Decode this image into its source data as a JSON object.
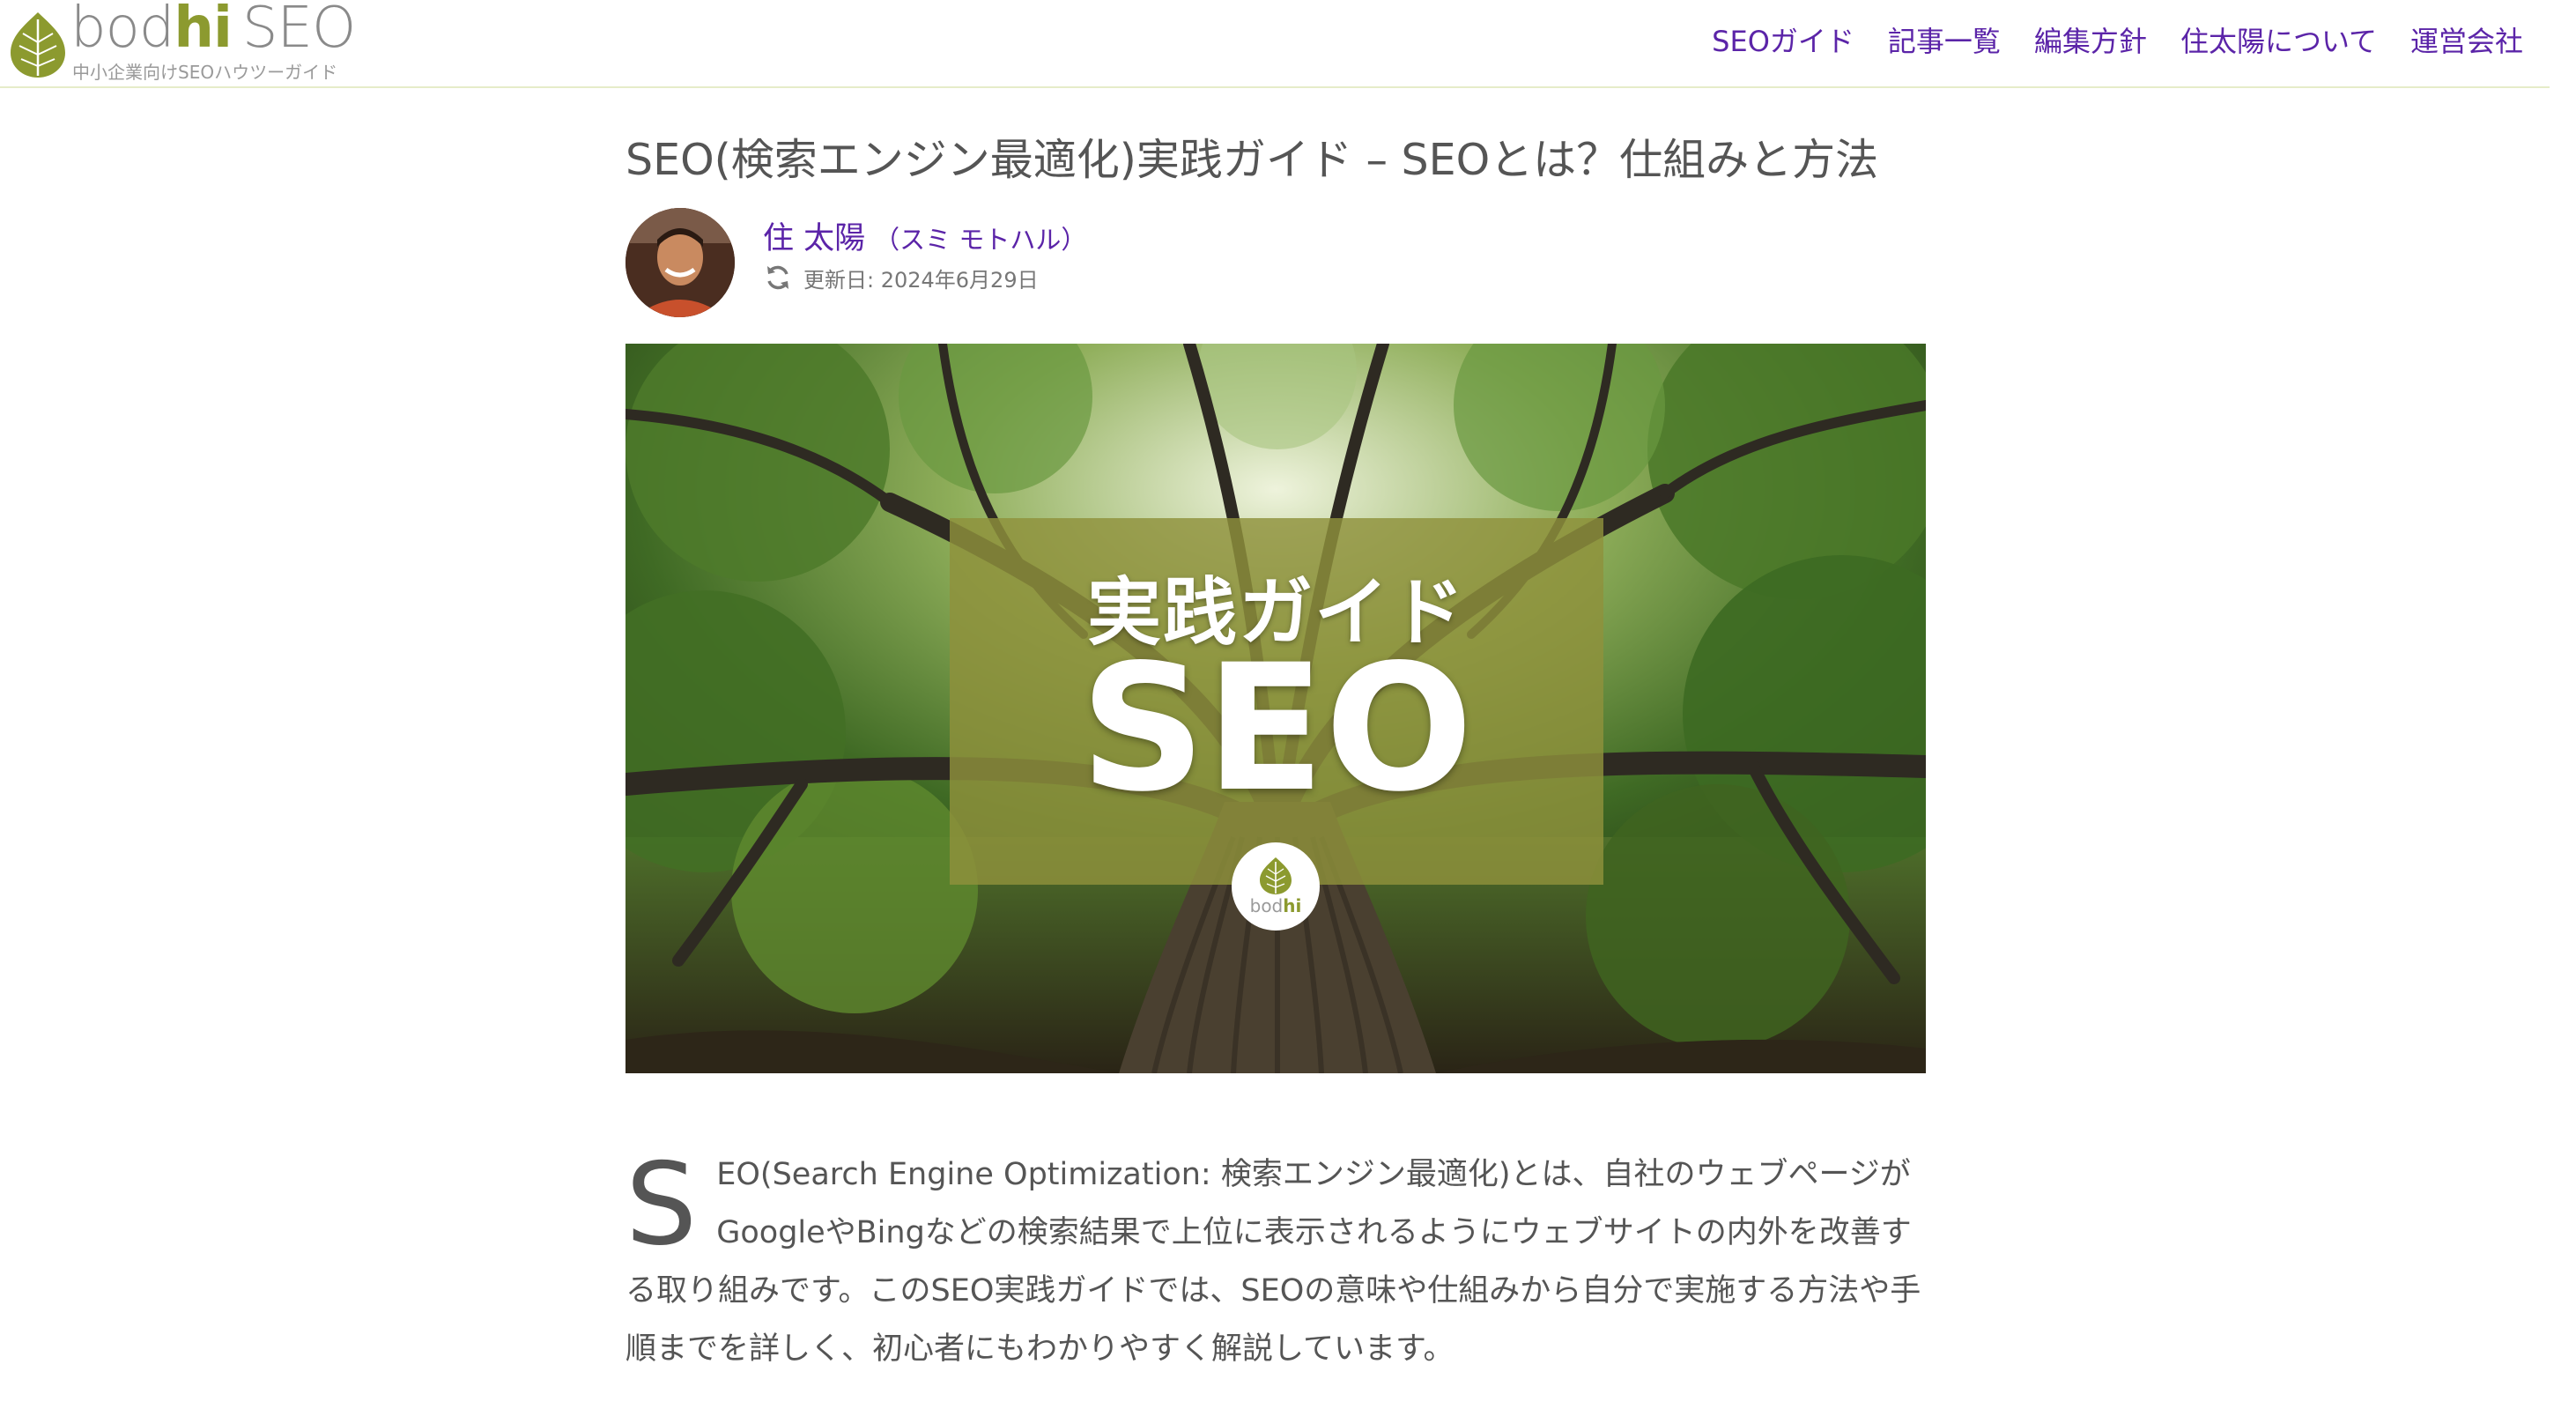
{
  "header": {
    "logo": {
      "wordmark_part1": "bod",
      "wordmark_part2": "hi",
      "wordmark_part3": "SEO",
      "tagline": "中小企業向けSEOハウツーガイド",
      "leaf_color": "#8c9a2f"
    },
    "nav": [
      {
        "label": "SEOガイド"
      },
      {
        "label": "記事一覧"
      },
      {
        "label": "編集方針"
      },
      {
        "label": "住太陽について"
      },
      {
        "label": "運営会社"
      }
    ],
    "nav_color": "#5b24a8"
  },
  "article": {
    "title": "SEO(検索エンジン最適化)実践ガイド – SEOとは？仕組みと方法",
    "author": {
      "name": "住 太陽",
      "kana": "（スミ モトハル）"
    },
    "updated": "更新日: 2024年6月29日",
    "hero": {
      "line1": "実践ガイド",
      "line2": "SEO",
      "badge_part1": "bod",
      "badge_part2": "hi"
    },
    "intro": {
      "dropcap": "S",
      "text": "EO(Search Engine Optimization: 検索エンジン最適化)とは、自社のウェブページがGoogleやBingなどの検索結果で上位に表示されるようにウェブサイトの内外を改善する取り組みです。このSEO実践ガイドでは、SEOの意味や仕組みから自分で実施する方法や手順までを詳しく、初心者にもわかりやすく解説しています。"
    }
  }
}
